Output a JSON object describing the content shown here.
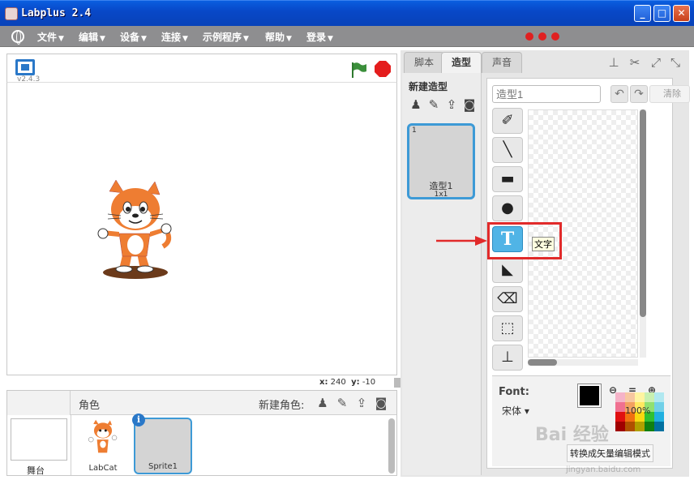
{
  "window": {
    "title": "Labplus 2.4",
    "min": "_",
    "max": "□",
    "close": "✕"
  },
  "menu": [
    {
      "label": "文件"
    },
    {
      "label": "编辑"
    },
    {
      "label": "设备"
    },
    {
      "label": "连接"
    },
    {
      "label": "示例程序"
    },
    {
      "label": "帮助"
    },
    {
      "label": "登录"
    }
  ],
  "stage": {
    "version": "v2.4.3",
    "x_label": "x:",
    "x_value": "240",
    "y_label": "y:",
    "y_value": "-10"
  },
  "sprites": {
    "header": "角色",
    "new_sprite": "新建角色:",
    "stage_label": "舞台",
    "items": [
      {
        "name": "LabCat"
      },
      {
        "name": "Sprite1"
      }
    ],
    "info": "i"
  },
  "tabs": [
    {
      "label": "脚本"
    },
    {
      "label": "造型"
    },
    {
      "label": "声音"
    }
  ],
  "costumes": {
    "new_costume": "新建造型",
    "item": {
      "index": "1",
      "name": "造型1",
      "size": "1x1"
    }
  },
  "editor": {
    "name_placeholder": "造型1",
    "clear": "清除",
    "font_label": "Font:",
    "font_value": "宋体",
    "zoom": "100%",
    "convert": "转换成矢量编辑模式",
    "tooltip": "文字",
    "text_tool": "T"
  },
  "watermark": {
    "brand": "Bai 经验",
    "url": "jingyan.baidu.com"
  },
  "colors": {
    "accent": "#3d9ad6",
    "highlight": "#e12a2a",
    "menu_bg": "#8e8e90"
  }
}
